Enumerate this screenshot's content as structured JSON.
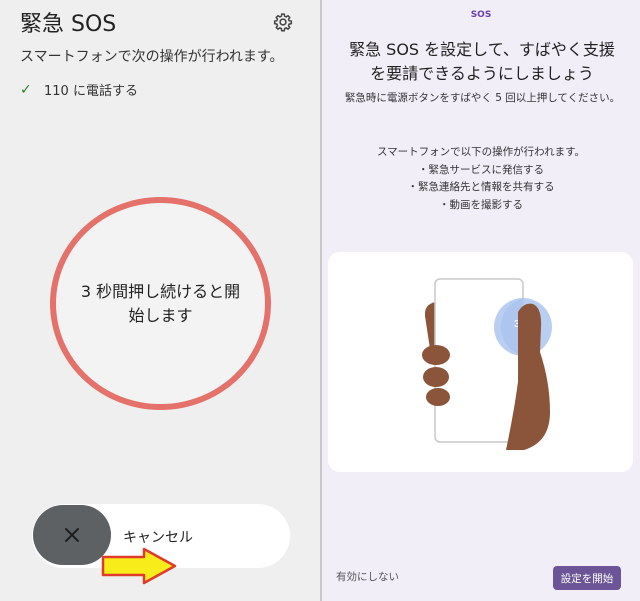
{
  "left_panel": {
    "title": "緊急 SOS",
    "description": "スマートフォンで次の操作が行われます。",
    "check_item": "110 に電話する",
    "countdown_text": "3 秒間押し続けると開始します",
    "cancel_label": "キャンセル",
    "colors": {
      "ring": "#e4726a",
      "knob": "#5e6163",
      "check": "#2e7d32",
      "arrow": "#f9ec1b"
    }
  },
  "right_panel": {
    "header": "SOS",
    "heading": "緊急 SOS を設定して、すばやく支援を要請できるようにしましょう",
    "subheading": "緊急時に電源ボタンをすばやく 5 回以上押してください。",
    "operations_intro": "スマートフォンで以下の操作が行われます。",
    "operations": [
      "・緊急サービスに発信する",
      "・緊急連絡先と情報を共有する",
      "・動画を撮影する"
    ],
    "illustration_number": "3",
    "disable_label": "有効にしない",
    "start_label": "設定を開始",
    "colors": {
      "accent": "#6b5596",
      "background": "#f2eef8",
      "skin": "#8a553a",
      "bubble": "#aec6ee"
    }
  }
}
